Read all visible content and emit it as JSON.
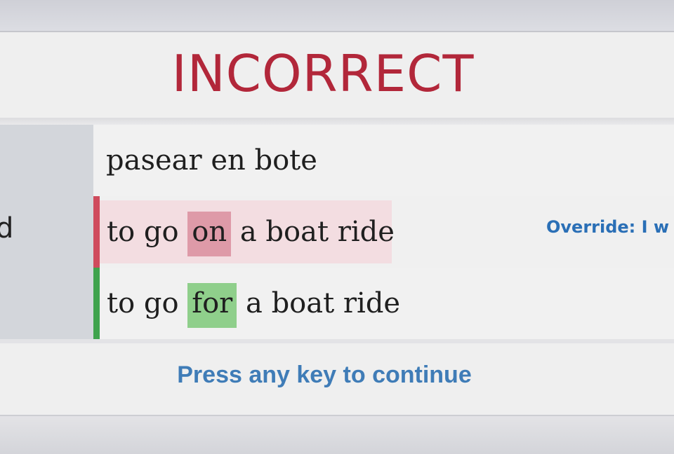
{
  "result": {
    "heading": "INCORRECT",
    "heading_color": "#b2273a"
  },
  "prompt": {
    "text": "pasear en bote"
  },
  "user_answer": {
    "before": "to go ",
    "wrong_word": "on",
    "after": " a boat ride",
    "status_color": "#cf4b5d"
  },
  "correct_answer": {
    "before": "to go ",
    "right_word": "for",
    "after": " a boat ride",
    "status_color": "#3fa34d"
  },
  "override": {
    "label": "Override: I w"
  },
  "left_column": {
    "glyph": "d"
  },
  "footer": {
    "continue_text": "Press any key to continue",
    "link_color": "#3f7cb7"
  }
}
